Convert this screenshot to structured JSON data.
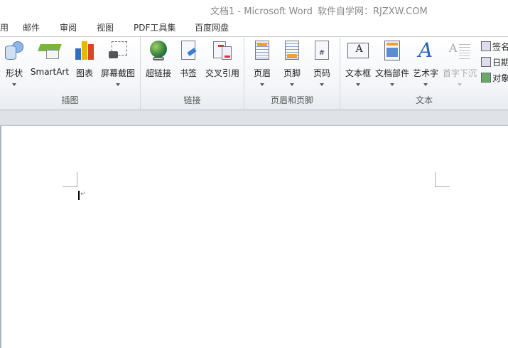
{
  "title": {
    "doc": "文档1  -  Microsoft Word",
    "site": "软件自学网：RJZXW.COM"
  },
  "tabs": [
    "引用",
    "邮件",
    "审阅",
    "视图",
    "PDF工具集",
    "百度网盘"
  ],
  "groups": {
    "illustrations": {
      "label": "插图",
      "buttons": [
        "形状",
        "SmartArt",
        "图表",
        "屏幕截图"
      ]
    },
    "links": {
      "label": "链接",
      "buttons": [
        "超链接",
        "书签",
        "交叉引用"
      ]
    },
    "header_footer": {
      "label": "页眉和页脚",
      "buttons": [
        "页眉",
        "页脚",
        "页码"
      ]
    },
    "text": {
      "label": "文本",
      "buttons": [
        "文本框",
        "文档部件",
        "艺术字",
        "首字下沉"
      ],
      "small": [
        "签名行",
        "日期和时间",
        "对象"
      ]
    }
  },
  "doc": {
    "para_mark": "↵"
  }
}
